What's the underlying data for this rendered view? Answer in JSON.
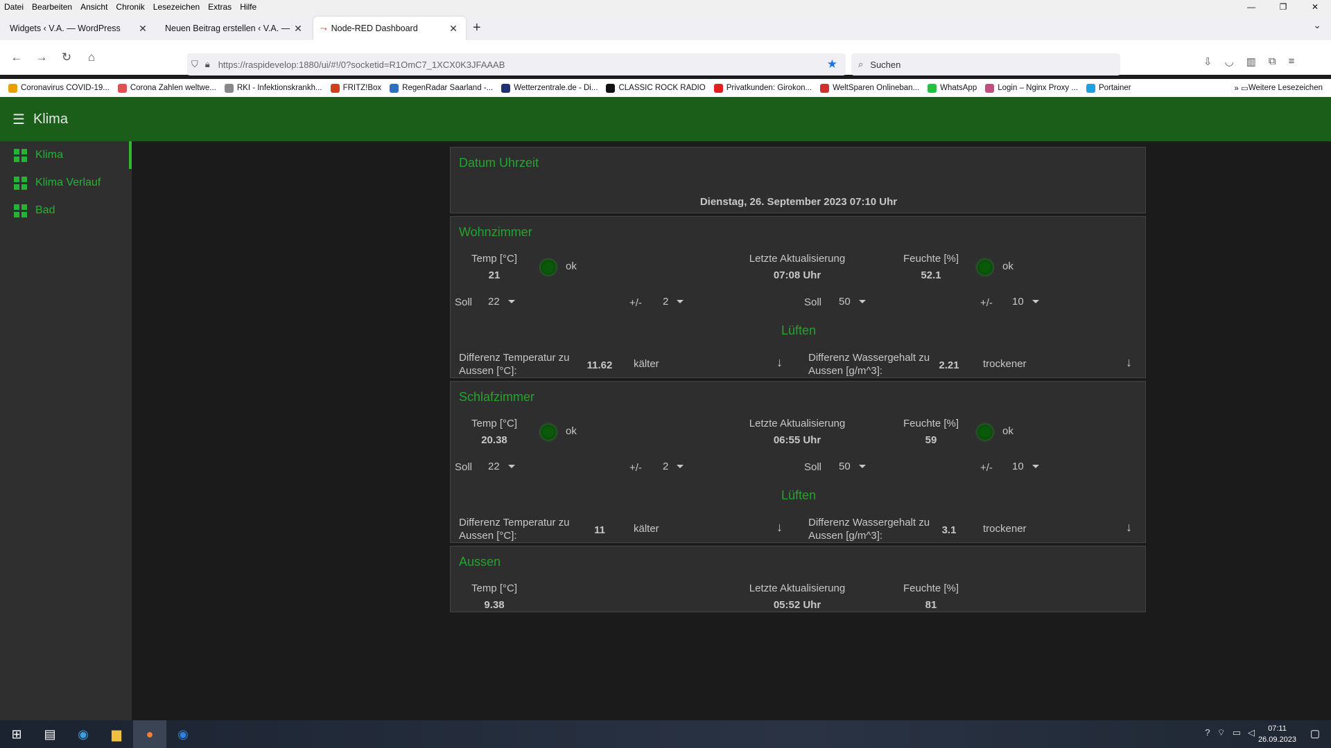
{
  "browser": {
    "menu": [
      "Datei",
      "Bearbeiten",
      "Ansicht",
      "Chronik",
      "Lesezeichen",
      "Extras",
      "Hilfe"
    ],
    "tabs": [
      {
        "title": "Widgets ‹ V.A. — WordPress"
      },
      {
        "title": "Neuen Beitrag erstellen ‹ V.A. — Wo"
      },
      {
        "title": "Node-RED Dashboard"
      }
    ],
    "url": "https://raspidevelop:1880/ui/#!/0?socketid=R1OmC7_1XCX0K3JFAAAB",
    "search_placeholder": "Suchen",
    "bookmarks": [
      {
        "label": "Coronavirus COVID-19...",
        "color": "#e8a000"
      },
      {
        "label": "Corona Zahlen weltwe...",
        "color": "#e05050"
      },
      {
        "label": "RKI - Infektionskrankh...",
        "color": "#888888"
      },
      {
        "label": "FRITZ!Box",
        "color": "#d04020"
      },
      {
        "label": "RegenRadar Saarland -...",
        "color": "#3070c0"
      },
      {
        "label": "Wetterzentrale.de - Di...",
        "color": "#203070"
      },
      {
        "label": "CLASSIC ROCK RADIO",
        "color": "#111111"
      },
      {
        "label": "Privatkunden: Girokon...",
        "color": "#e02020"
      },
      {
        "label": "WeltSparen Onlineban...",
        "color": "#d03030"
      },
      {
        "label": "WhatsApp",
        "color": "#25c040"
      },
      {
        "label": "Login – Nginx Proxy ...",
        "color": "#c05080"
      },
      {
        "label": "Portainer",
        "color": "#20a0e0"
      }
    ],
    "more_bookmarks": "Weitere Lesezeichen"
  },
  "app": {
    "title": "Klima",
    "sidebar": [
      {
        "label": "Klima"
      },
      {
        "label": "Klima Verlauf"
      },
      {
        "label": "Bad"
      }
    ]
  },
  "datum": {
    "title": "Datum Uhrzeit",
    "value": "Dienstag, 26. September 2023 07:10 Uhr"
  },
  "wohnzimmer": {
    "title": "Wohnzimmer",
    "temp_label": "Temp [°C]",
    "temp": "21",
    "temp_status": "ok",
    "update_label": "Letzte Aktualisierung",
    "update": "07:08 Uhr",
    "hum_label": "Feuchte [%]",
    "hum": "52.1",
    "hum_status": "ok",
    "soll_label": "Soll",
    "soll_temp": "22",
    "pm_label": "+/-",
    "pm_temp": "2",
    "soll_hum": "50",
    "pm_hum": "10",
    "lueften": "Lüften",
    "diff_temp_label": "Differenz Temperatur zu Aussen [°C]:",
    "diff_temp": "11.62",
    "diff_temp_text": "kälter",
    "diff_water_label": "Differenz Wassergehalt zu Aussen [g/m^3]:",
    "diff_water": "2.21",
    "diff_water_text": "trockener"
  },
  "schlafzimmer": {
    "title": "Schlafzimmer",
    "temp_label": "Temp [°C]",
    "temp": "20.38",
    "temp_status": "ok",
    "update_label": "Letzte Aktualisierung",
    "update": "06:55 Uhr",
    "hum_label": "Feuchte [%]",
    "hum": "59",
    "hum_status": "ok",
    "soll_label": "Soll",
    "soll_temp": "22",
    "pm_label": "+/-",
    "pm_temp": "2",
    "soll_hum": "50",
    "pm_hum": "10",
    "lueften": "Lüften",
    "diff_temp_label": "Differenz Temperatur zu Aussen [°C]:",
    "diff_temp": "11",
    "diff_temp_text": "kälter",
    "diff_water_label": "Differenz Wassergehalt zu Aussen [g/m^3]:",
    "diff_water": "3.1",
    "diff_water_text": "trockener"
  },
  "aussen": {
    "title": "Aussen",
    "temp_label": "Temp [°C]",
    "temp": "9.38",
    "update_label": "Letzte Aktualisierung",
    "update": "05:52 Uhr",
    "hum_label": "Feuchte [%]",
    "hum": "81"
  },
  "taskbar": {
    "time": "07:11",
    "date": "26.09.2023"
  },
  "colors": {
    "header": "#1a5e1a",
    "accent": "#22a52e",
    "card": "#2e2e2e"
  }
}
